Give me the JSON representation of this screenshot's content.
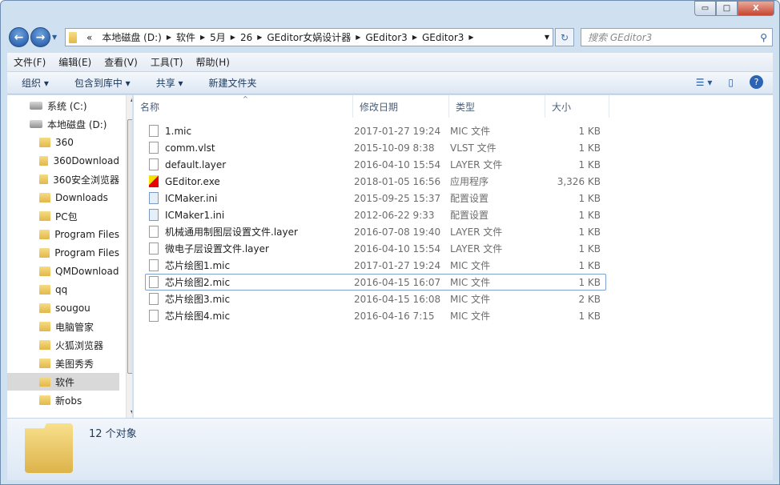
{
  "window": {
    "minimize": "▭",
    "maximize": "□",
    "close": "X"
  },
  "address": {
    "overflow": "«",
    "segments": [
      "本地磁盘 (D:)",
      "软件",
      "5月",
      "26",
      "GEditor女娲设计器",
      "GEditor3",
      "GEditor3"
    ],
    "search_placeholder": "搜索 GEditor3"
  },
  "menu": [
    "文件(F)",
    "编辑(E)",
    "查看(V)",
    "工具(T)",
    "帮助(H)"
  ],
  "toolbar": {
    "organize": "组织 ▾",
    "include": "包含到库中 ▾",
    "share": "共享 ▾",
    "new_folder": "新建文件夹"
  },
  "sidebar": {
    "items": [
      {
        "label": "系统 (C:)",
        "type": "drive"
      },
      {
        "label": "本地磁盘 (D:)",
        "type": "drive"
      },
      {
        "label": "360",
        "type": "folder"
      },
      {
        "label": "360Download",
        "type": "folder"
      },
      {
        "label": "360安全浏览器",
        "type": "folder"
      },
      {
        "label": "Downloads",
        "type": "folder"
      },
      {
        "label": "PC包",
        "type": "folder"
      },
      {
        "label": "Program Files",
        "type": "folder"
      },
      {
        "label": "Program Files",
        "type": "folder"
      },
      {
        "label": "QMDownload",
        "type": "folder"
      },
      {
        "label": "qq",
        "type": "folder"
      },
      {
        "label": "sougou",
        "type": "folder"
      },
      {
        "label": "电脑管家",
        "type": "folder"
      },
      {
        "label": "火狐浏览器",
        "type": "folder"
      },
      {
        "label": "美图秀秀",
        "type": "folder"
      },
      {
        "label": "软件",
        "type": "folder",
        "selected": true
      },
      {
        "label": "新obs",
        "type": "folder"
      }
    ]
  },
  "columns": [
    "名称",
    "修改日期",
    "类型",
    "大小"
  ],
  "files": [
    {
      "name": "1.mic",
      "date": "2017-01-27 19:24",
      "type": "MIC 文件",
      "size": "1 KB",
      "icon": "file"
    },
    {
      "name": "comm.vlst",
      "date": "2015-10-09 8:38",
      "type": "VLST 文件",
      "size": "1 KB",
      "icon": "file"
    },
    {
      "name": "default.layer",
      "date": "2016-04-10 15:54",
      "type": "LAYER 文件",
      "size": "1 KB",
      "icon": "file"
    },
    {
      "name": "GEditor.exe",
      "date": "2018-01-05 16:56",
      "type": "应用程序",
      "size": "3,326 KB",
      "icon": "exe"
    },
    {
      "name": "ICMaker.ini",
      "date": "2015-09-25 15:37",
      "type": "配置设置",
      "size": "1 KB",
      "icon": "ini"
    },
    {
      "name": "ICMaker1.ini",
      "date": "2012-06-22 9:33",
      "type": "配置设置",
      "size": "1 KB",
      "icon": "ini"
    },
    {
      "name": "机械通用制图层设置文件.layer",
      "date": "2016-07-08 19:40",
      "type": "LAYER 文件",
      "size": "1 KB",
      "icon": "file"
    },
    {
      "name": "微电子层设置文件.layer",
      "date": "2016-04-10 15:54",
      "type": "LAYER 文件",
      "size": "1 KB",
      "icon": "file"
    },
    {
      "name": "芯片绘图1.mic",
      "date": "2017-01-27 19:24",
      "type": "MIC 文件",
      "size": "1 KB",
      "icon": "file"
    },
    {
      "name": "芯片绘图2.mic",
      "date": "2016-04-15 16:07",
      "type": "MIC 文件",
      "size": "1 KB",
      "icon": "file",
      "focused": true
    },
    {
      "name": "芯片绘图3.mic",
      "date": "2016-04-15 16:08",
      "type": "MIC 文件",
      "size": "2 KB",
      "icon": "file"
    },
    {
      "name": "芯片绘图4.mic",
      "date": "2016-04-16 7:15",
      "type": "MIC 文件",
      "size": "1 KB",
      "icon": "file"
    }
  ],
  "details": {
    "count": "12 个对象"
  }
}
